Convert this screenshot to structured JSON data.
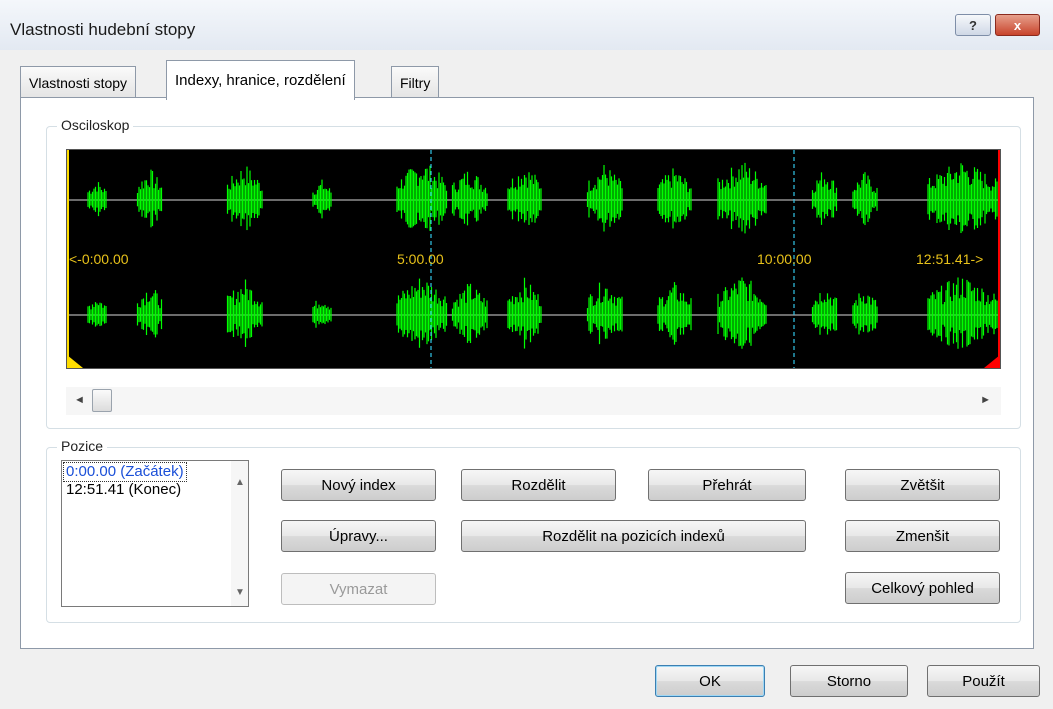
{
  "window": {
    "title": "Vlastnosti hudební stopy",
    "help_label": "?",
    "close_label": "x"
  },
  "tabs": [
    {
      "label": "Vlastnosti stopy",
      "active": false
    },
    {
      "label": "Indexy, hranice, rozdělení",
      "active": true
    },
    {
      "label": "Filtry",
      "active": false
    }
  ],
  "oscilloscope": {
    "group_label": "Osciloskop",
    "time_labels": [
      "<-0:00.00",
      "5:00.00",
      "10:00.00",
      "12:51.41->"
    ],
    "colors": {
      "waveform": "#00ff00",
      "background": "#000000",
      "marker": "#33c6e8",
      "start_marker": "#ffdd00",
      "end_marker": "#ff0000"
    }
  },
  "scrollbar": {
    "left_arrow": "◄",
    "right_arrow": "►"
  },
  "position": {
    "group_label": "Pozice",
    "items": [
      "0:00.00 (Začátek)",
      "12:51.41 (Konec)"
    ],
    "selected_index": 0
  },
  "buttons": {
    "new_index": "Nový index",
    "edit": "Úpravy...",
    "delete": "Vymazat",
    "split": "Rozdělit",
    "split_at_indexes": "Rozdělit na pozicích indexů",
    "play": "Přehrát",
    "zoom_in": "Zvětšit",
    "zoom_out": "Zmenšit",
    "full_view": "Celkový pohled"
  },
  "footer": {
    "ok": "OK",
    "cancel": "Storno",
    "apply": "Použít"
  }
}
